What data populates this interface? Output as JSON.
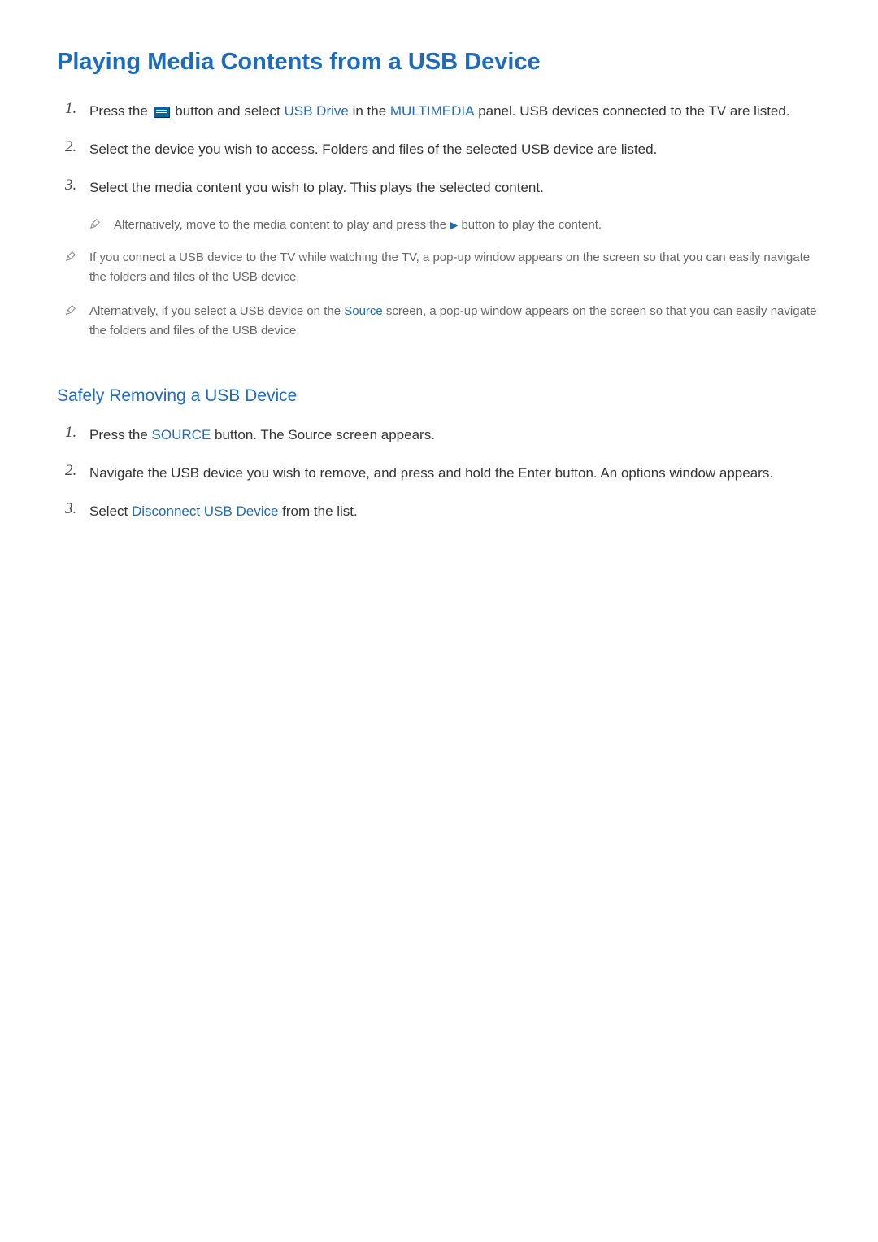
{
  "section1": {
    "heading": "Playing Media Contents from a USB Device",
    "steps": [
      {
        "num": "1.",
        "before": "Press the ",
        "after1": " button and select ",
        "kw1": "USB Drive",
        "mid": " in the ",
        "kw2": "MULTIMEDIA",
        "after2": " panel. USB devices connected to the TV are listed."
      },
      {
        "num": "2.",
        "text": "Select the device you wish to access. Folders and files of the selected USB device are listed."
      },
      {
        "num": "3.",
        "text": "Select the media content you wish to play. This plays the selected content."
      }
    ],
    "subnote": {
      "before": "Alternatively, move to the media content to play and press the ",
      "arrow": "▶",
      "after": " button to play the content."
    },
    "notes": [
      "If you connect a USB device to the TV while watching the TV, a pop-up window appears on the screen so that you can easily navigate the folders and files of the USB device.",
      {
        "before": "Alternatively, if you select a USB device on the ",
        "kw": "Source",
        "after": " screen, a pop-up window appears on the screen so that you can easily navigate the folders and files of the USB device."
      }
    ]
  },
  "section2": {
    "heading": "Safely Removing a USB Device",
    "steps": [
      {
        "num": "1.",
        "before": "Press the ",
        "kw": "SOURCE",
        "after": " button. The Source screen appears."
      },
      {
        "num": "2.",
        "text": "Navigate the USB device you wish to remove, and press and hold the Enter button. An options window appears."
      },
      {
        "num": "3.",
        "before": "Select ",
        "kw": "Disconnect USB Device",
        "after": " from the list."
      }
    ]
  }
}
